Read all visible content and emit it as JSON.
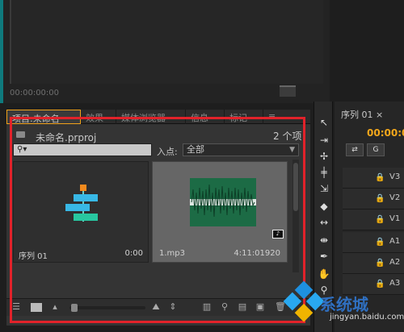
{
  "monitor": {
    "timecode": "00:00:00:00"
  },
  "project_panel": {
    "tabs": [
      {
        "label": "项目:未命名",
        "active": true
      },
      {
        "label": "效果"
      },
      {
        "label": "媒体浏览器"
      },
      {
        "label": "信息"
      },
      {
        "label": "标记"
      }
    ],
    "menu_icon": "≡",
    "project_name": "未命名.prproj",
    "item_count": "2 个项",
    "search": {
      "value": "",
      "icon": "search-icon"
    },
    "inpoint_label": "入点:",
    "inpoint_value": "全部",
    "items": [
      {
        "name": "序列 01",
        "duration": "0:00",
        "kind": "sequence"
      },
      {
        "name": "1.mp3",
        "duration": "4:11:01920",
        "kind": "audio"
      }
    ]
  },
  "tools": [
    "selection-tool",
    "track-select-tool",
    "ripple-edit-tool",
    "rolling-edit-tool",
    "rate-stretch-tool",
    "razor-tool",
    "slip-tool",
    "slide-tool",
    "pen-tool",
    "hand-tool",
    "zoom-tool"
  ],
  "timeline": {
    "tab_label": "序列 01 ×",
    "time": "00:00:0",
    "tracks": [
      {
        "name": "V3"
      },
      {
        "name": "V2"
      },
      {
        "name": "V1"
      },
      {
        "name": "A1"
      },
      {
        "name": "A2"
      },
      {
        "name": "A3"
      }
    ],
    "a1_source": "A1"
  },
  "watermark": {
    "brand": "系统城",
    "url": "jingyan.baidu.com"
  },
  "colors": {
    "accent_orange": "#f2a71b",
    "highlight_red": "#e1222a",
    "timecode_orange": "#f2a71b",
    "audio_wave": "#1c6b45"
  }
}
